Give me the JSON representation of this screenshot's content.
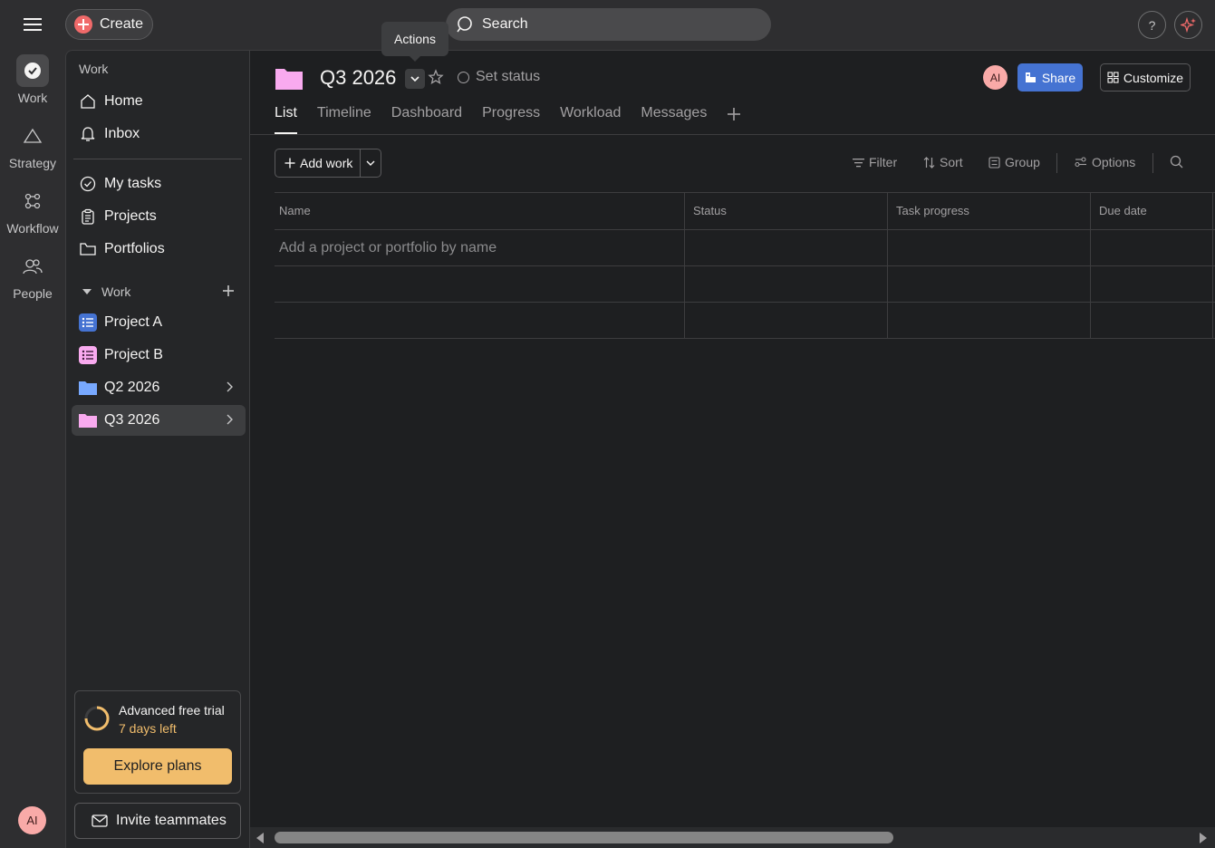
{
  "topbar": {
    "create_label": "Create",
    "search_placeholder": "Search",
    "help_label": "?"
  },
  "rail": {
    "items": [
      {
        "label": "Work",
        "icon": "check-circle-icon"
      },
      {
        "label": "Strategy",
        "icon": "triangle-icon"
      },
      {
        "label": "Workflow",
        "icon": "workflow-icon"
      },
      {
        "label": "People",
        "icon": "people-icon"
      }
    ],
    "avatar": "AI"
  },
  "sidebar": {
    "heading": "Work",
    "nav": [
      {
        "label": "Home",
        "icon": "home-icon"
      },
      {
        "label": "Inbox",
        "icon": "bell-icon"
      }
    ],
    "nav2": [
      {
        "label": "My tasks",
        "icon": "check-circle-icon"
      },
      {
        "label": "Projects",
        "icon": "clipboard-icon"
      },
      {
        "label": "Portfolios",
        "icon": "folder-icon"
      }
    ],
    "section_label": "Work",
    "work_items": [
      {
        "label": "Project A",
        "icon": "list-icon",
        "color": "#4573d2"
      },
      {
        "label": "Project B",
        "icon": "list-icon",
        "color": "#f9aaef"
      },
      {
        "label": "Q2 2026",
        "icon": "folder-icon",
        "color": "#78a9ff"
      },
      {
        "label": "Q3 2026",
        "icon": "folder-icon",
        "color": "#f9aaef"
      }
    ],
    "trial": {
      "title": "Advanced free trial",
      "days": "7 days left",
      "progress": 0.75,
      "explore_label": "Explore plans"
    },
    "invite_label": "Invite teammates"
  },
  "main": {
    "title": "Q3 2026",
    "set_status": "Set status",
    "avatar": "AI",
    "share_label": "Share",
    "customize_label": "Customize",
    "tabs": [
      "List",
      "Timeline",
      "Dashboard",
      "Progress",
      "Workload",
      "Messages"
    ],
    "add_work_label": "Add work",
    "toolbar": {
      "filter": "Filter",
      "sort": "Sort",
      "group": "Group",
      "options": "Options"
    },
    "columns": [
      "Name",
      "Status",
      "Task progress",
      "Due date"
    ],
    "add_row_placeholder": "Add a project or portfolio by name",
    "tooltip": "Actions"
  },
  "colors": {
    "accent_blue": "#4573d2",
    "create_red": "#f06a6a",
    "trial_gold": "#f1bd6c",
    "avatar_pink": "#f9aaa8"
  }
}
